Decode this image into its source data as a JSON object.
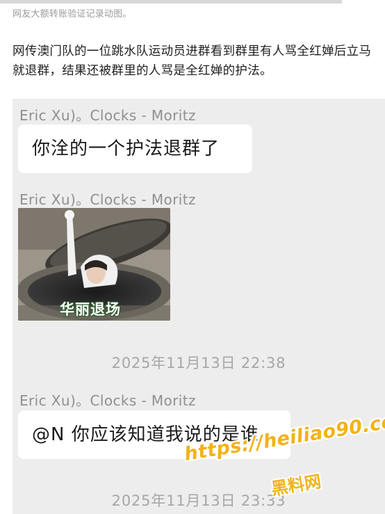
{
  "caption": "网友大额转账验证记录动图。",
  "article": {
    "line1": "网传澳门队的一位跳水队运动员进群看到群里有人骂全红婵后立马",
    "line2": "就退群，结果还被群里的人骂是全红婵的护法。"
  },
  "chat": {
    "messages": [
      {
        "sender": "Eric Xu)。Clocks - Moritz",
        "text": "你洤的一个护法退群了"
      },
      {
        "sender": "Eric Xu)。Clocks - Moritz",
        "sticker_caption": "华丽退场"
      },
      {
        "sender": "Eric Xu)。Clocks - Moritz",
        "text": "@N 你应该知道我说的是谁"
      }
    ],
    "timestamps": [
      "2025年11月13日 22:38",
      "2025年11月13日 23:33"
    ]
  },
  "watermark": {
    "url": "https://heiliao90.com",
    "name": "黑料网",
    "color": "#f3b21a"
  }
}
